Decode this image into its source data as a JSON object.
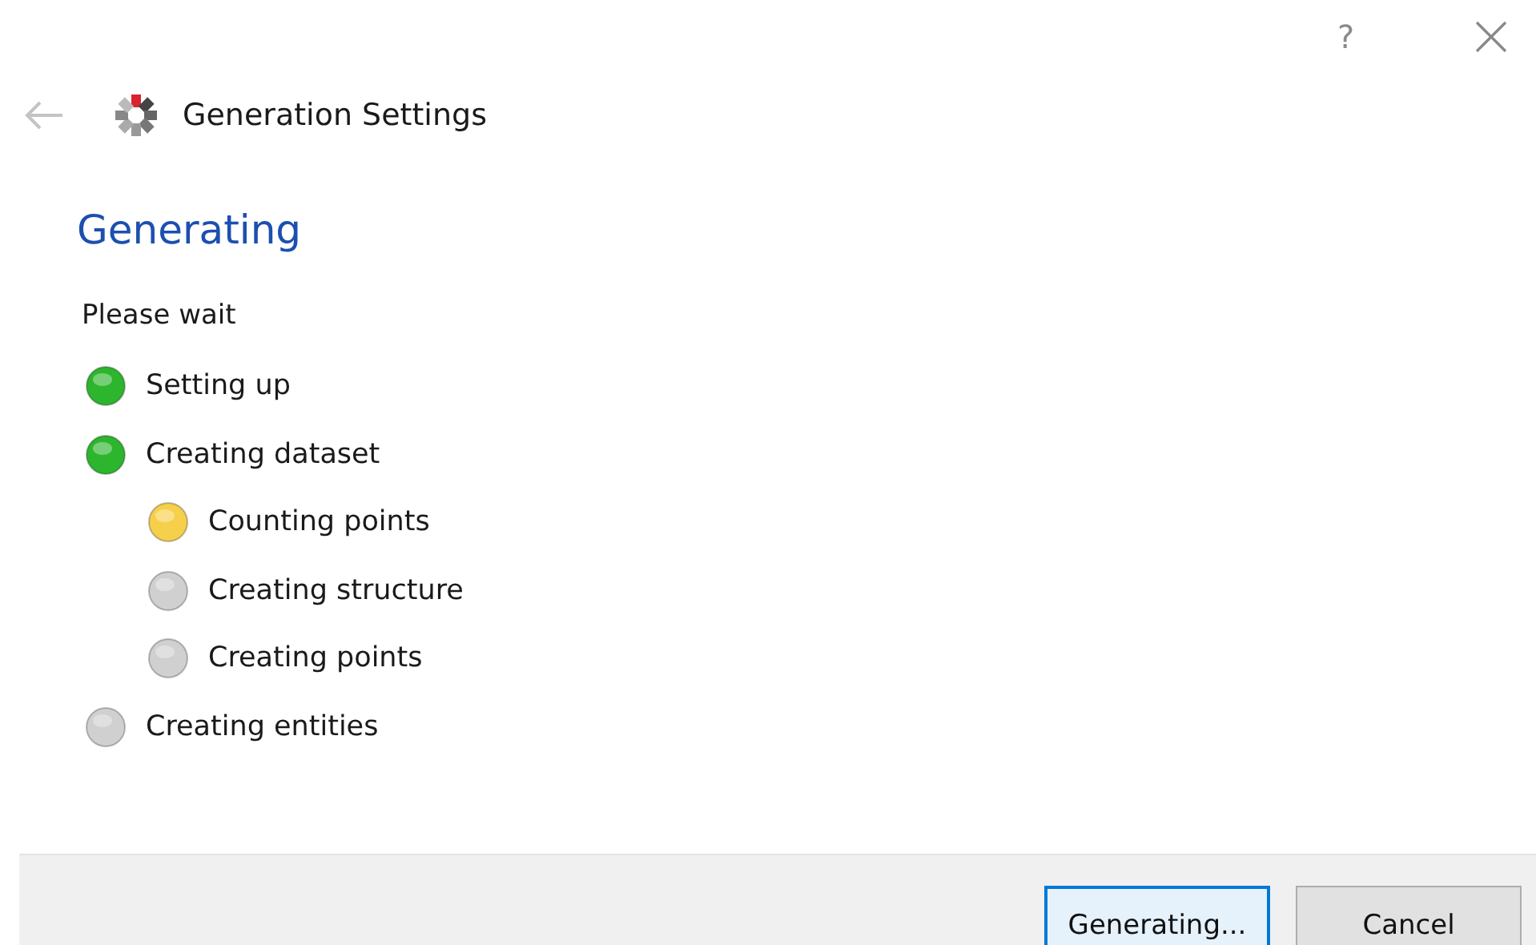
{
  "title_bar": {
    "help": "?"
  },
  "header": {
    "back_disabled": true,
    "title": "Generation Settings"
  },
  "heading": "Generating",
  "subtitle": "Please wait",
  "steps": [
    {
      "label": "Setting up",
      "color": "#2db52d"
    },
    {
      "label": "Creating dataset",
      "color": "#2db52d",
      "children": [
        {
          "label": "Counting points",
          "color": "#f6d04a"
        },
        {
          "label": "Creating structure",
          "color": "#d0d0d0"
        },
        {
          "label": "Creating points",
          "color": "#d0d0d0"
        }
      ]
    },
    {
      "label": "Creating entities",
      "color": "#d0d0d0"
    }
  ],
  "buttons": [
    {
      "label": "Generating...",
      "default": true
    },
    {
      "label": "Cancel",
      "default": false
    }
  ]
}
